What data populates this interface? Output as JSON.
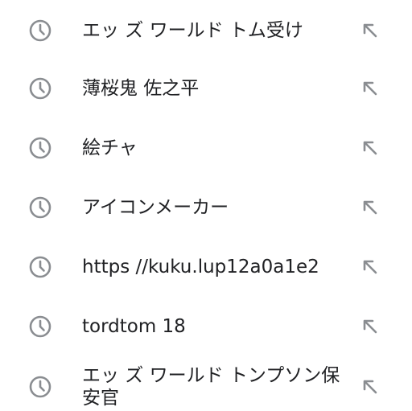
{
  "history": {
    "items": [
      {
        "text": "エッ ズ ワールド トム受け",
        "icon": "history-clock-icon",
        "action_icon": "fill-query-arrow-icon"
      },
      {
        "text": "薄桜鬼 佐之平",
        "icon": "history-clock-icon",
        "action_icon": "fill-query-arrow-icon"
      },
      {
        "text": "絵チャ",
        "icon": "history-clock-icon",
        "action_icon": "fill-query-arrow-icon"
      },
      {
        "text": "アイコンメーカー",
        "icon": "history-clock-icon",
        "action_icon": "fill-query-arrow-icon"
      },
      {
        "text": "https //kuku.lup12a0a1e2",
        "icon": "history-clock-icon",
        "action_icon": "fill-query-arrow-icon"
      },
      {
        "text": "tordtom 18",
        "icon": "history-clock-icon",
        "action_icon": "fill-query-arrow-icon"
      },
      {
        "text": "エッ ズ ワールド トンプソン保安官",
        "icon": "history-clock-icon",
        "action_icon": "fill-query-arrow-icon"
      }
    ]
  },
  "colors": {
    "icon": "#8a8d91",
    "text": "#202124",
    "background": "#ffffff"
  }
}
